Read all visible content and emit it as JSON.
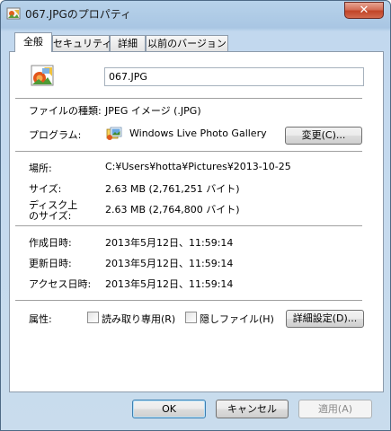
{
  "window": {
    "title": "067.JPGのプロパティ",
    "close_label": "✕"
  },
  "tabs": [
    {
      "label": "全般",
      "active": true
    },
    {
      "label": "セキュリティ",
      "active": false
    },
    {
      "label": "詳細",
      "active": false
    },
    {
      "label": "以前のバージョン",
      "active": false
    }
  ],
  "general": {
    "file_name": "067.JPG",
    "file_type_label": "ファイルの種類:",
    "file_type_value": "JPEG イメージ (.JPG)",
    "program_label": "プログラム:",
    "program_value": "Windows Live Photo Gallery",
    "change_button": "変更(C)...",
    "location_label": "場所:",
    "location_value": "C:¥Users¥hotta¥Pictures¥2013-10-25",
    "size_label": "サイズ:",
    "size_value": "2.63 MB (2,761,251 バイト)",
    "disk_size_label_1": "ディスク上",
    "disk_size_label_2": "のサイズ:",
    "disk_size_value": "2.63 MB (2,764,800 バイト)",
    "created_label": "作成日時:",
    "created_value": "2013年5月12日、11:59:14",
    "modified_label": "更新日時:",
    "modified_value": "2013年5月12日、11:59:14",
    "accessed_label": "アクセス日時:",
    "accessed_value": "2013年5月12日、11:59:14",
    "attributes_label": "属性:",
    "readonly_label": "読み取り専用(R)",
    "hidden_label": "隠しファイル(H)",
    "advanced_button": "詳細設定(D)..."
  },
  "buttons": {
    "ok": "OK",
    "cancel": "キャンセル",
    "apply": "適用(A)"
  }
}
